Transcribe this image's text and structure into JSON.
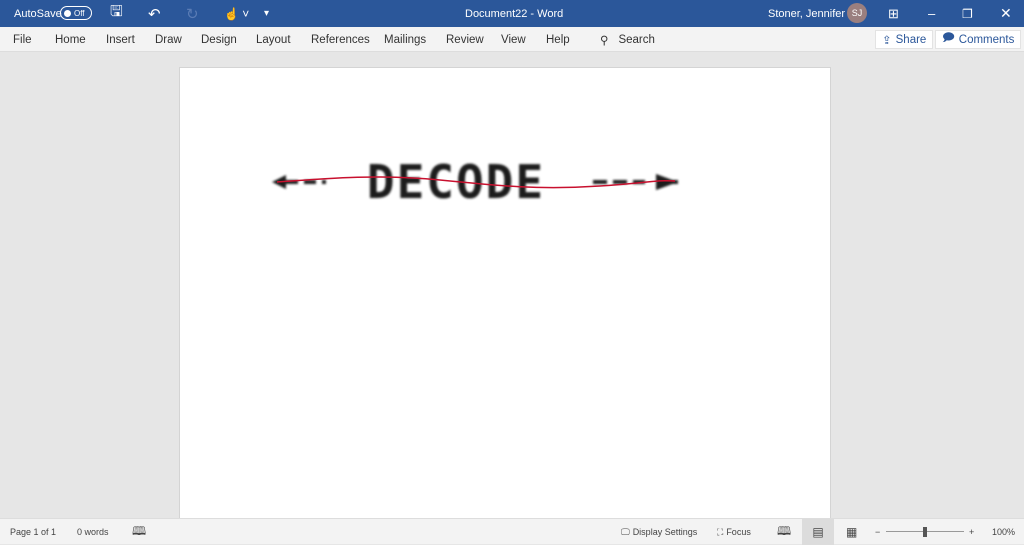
{
  "titlebar": {
    "autosave_label": "AutoSave",
    "autosave_state": "Off",
    "title": "Document22  -  Word",
    "user": "Stoner, Jennifer L",
    "initials": "SJ"
  },
  "ribbon": {
    "tabs": [
      "File",
      "Home",
      "Insert",
      "Draw",
      "Design",
      "Layout",
      "References",
      "Mailings",
      "Review",
      "View",
      "Help"
    ],
    "search": "Search",
    "share": "Share",
    "comments": "Comments"
  },
  "document": {
    "image_text": "DECODE"
  },
  "status": {
    "page": "Page 1 of 1",
    "words": "0 words",
    "display_settings": "Display Settings",
    "focus": "Focus",
    "zoom": "100%",
    "zoom_level_percent": 100
  },
  "colors": {
    "brand": "#2b579a",
    "ink_line": "#c8102e"
  }
}
